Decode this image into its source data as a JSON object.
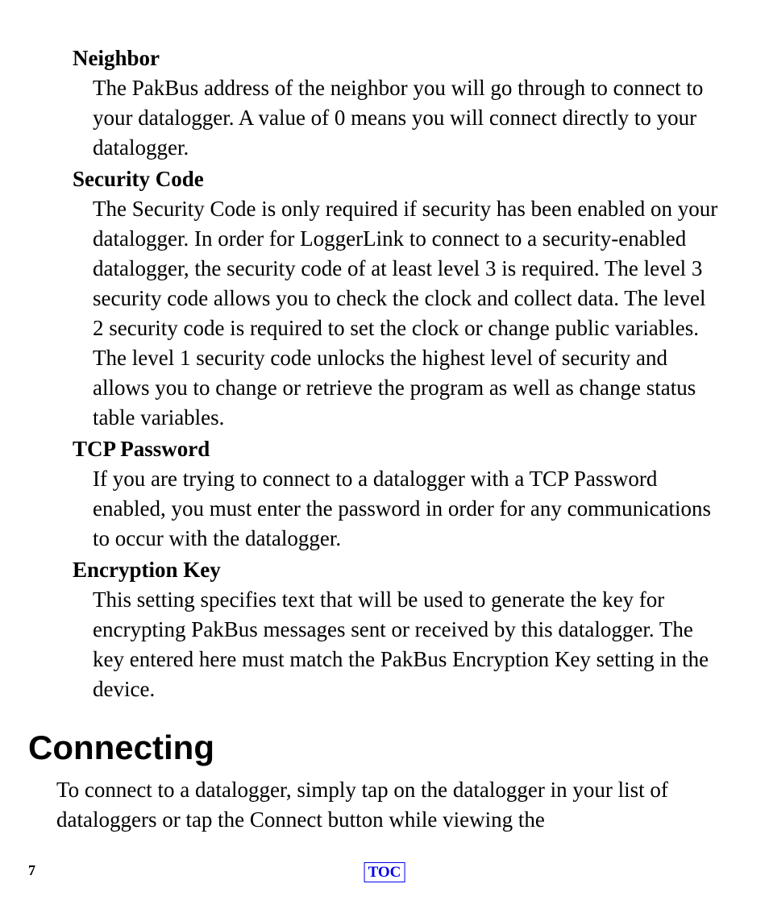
{
  "definitions": [
    {
      "term": "Neighbor",
      "body": "The PakBus address of the neighbor you will go through to connect to your datalogger.  A value of 0 means you will connect directly to your datalogger."
    },
    {
      "term": "Security Code",
      "body": "The Security Code is only required if security has been enabled on your datalogger. In order for LoggerLink to connect to a security-enabled datalogger, the security code of at least level 3 is required. The level 3 security code allows you to check the clock and collect data. The level 2 security code is required to set the clock or change public variables. The level 1 security code unlocks the highest level of security and allows you to change or retrieve the program as well as change status table variables."
    },
    {
      "term": "TCP Password",
      "body": "If you are trying to connect to a datalogger with a TCP Password enabled, you must enter the password in order for any communications to occur with the datalogger."
    },
    {
      "term": "Encryption Key",
      "body": "This setting specifies text that will be used to generate the key for encrypting PakBus messages sent or received by this datalogger.  The key entered here must match the PakBus Encryption Key setting in the device."
    }
  ],
  "section": {
    "heading": "Connecting",
    "body": "To connect to a datalogger, simply tap on the datalogger in your list of dataloggers or tap the Connect button while viewing the"
  },
  "footer": {
    "page_number": "7",
    "toc_label": "TOC"
  }
}
